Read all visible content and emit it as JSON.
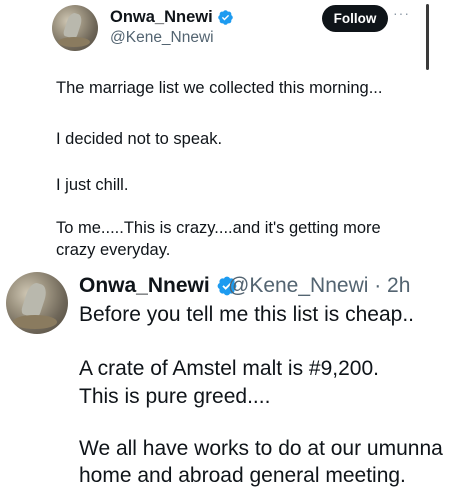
{
  "top_tweet": {
    "name": "Onwa_Nnewi",
    "handle": "@Kene_Nnewi",
    "follow_label": "Follow",
    "more_label": "···",
    "body_lines": [
      "The marriage list we collected this morning...",
      "I decided not to speak.",
      "I just chill.",
      "To me.....This is crazy....and it's getting more",
      "crazy everyday."
    ]
  },
  "quoted_tweet": {
    "name": "Onwa_Nnewi",
    "handle_time": "@Kene_Nnewi · 2h",
    "body_lines": [
      "Before you tell me this list is cheap..",
      "A crate of Amstel malt is #9,200.",
      "This is pure greed....",
      "We all have works to do at our umunna",
      "home and abroad general meeting."
    ]
  },
  "colors": {
    "verified": "#1d9bf0",
    "text": "#0f1419",
    "muted": "#536471"
  },
  "icons": {
    "verified": "verified-badge-icon",
    "more": "more-options-icon"
  }
}
